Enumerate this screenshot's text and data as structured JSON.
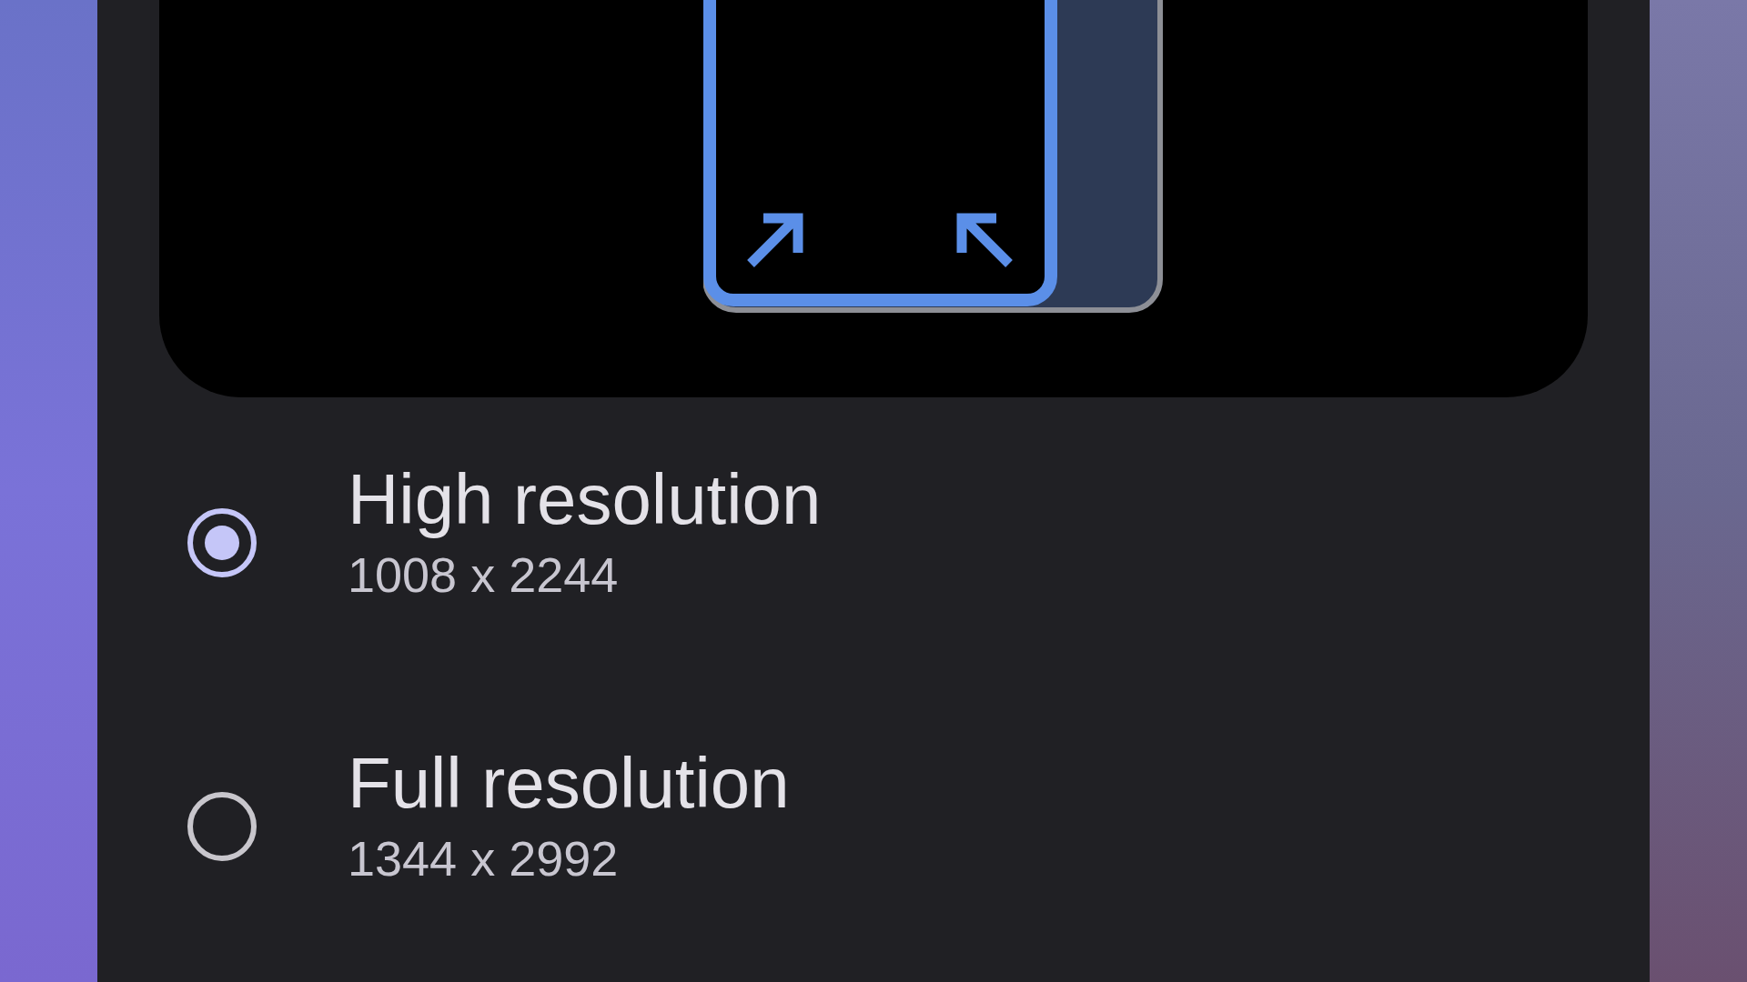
{
  "options": [
    {
      "title": "High resolution",
      "subtitle": "1008 x 2244",
      "selected": true
    },
    {
      "title": "Full resolution",
      "subtitle": "1344 x 2992",
      "selected": false
    }
  ]
}
